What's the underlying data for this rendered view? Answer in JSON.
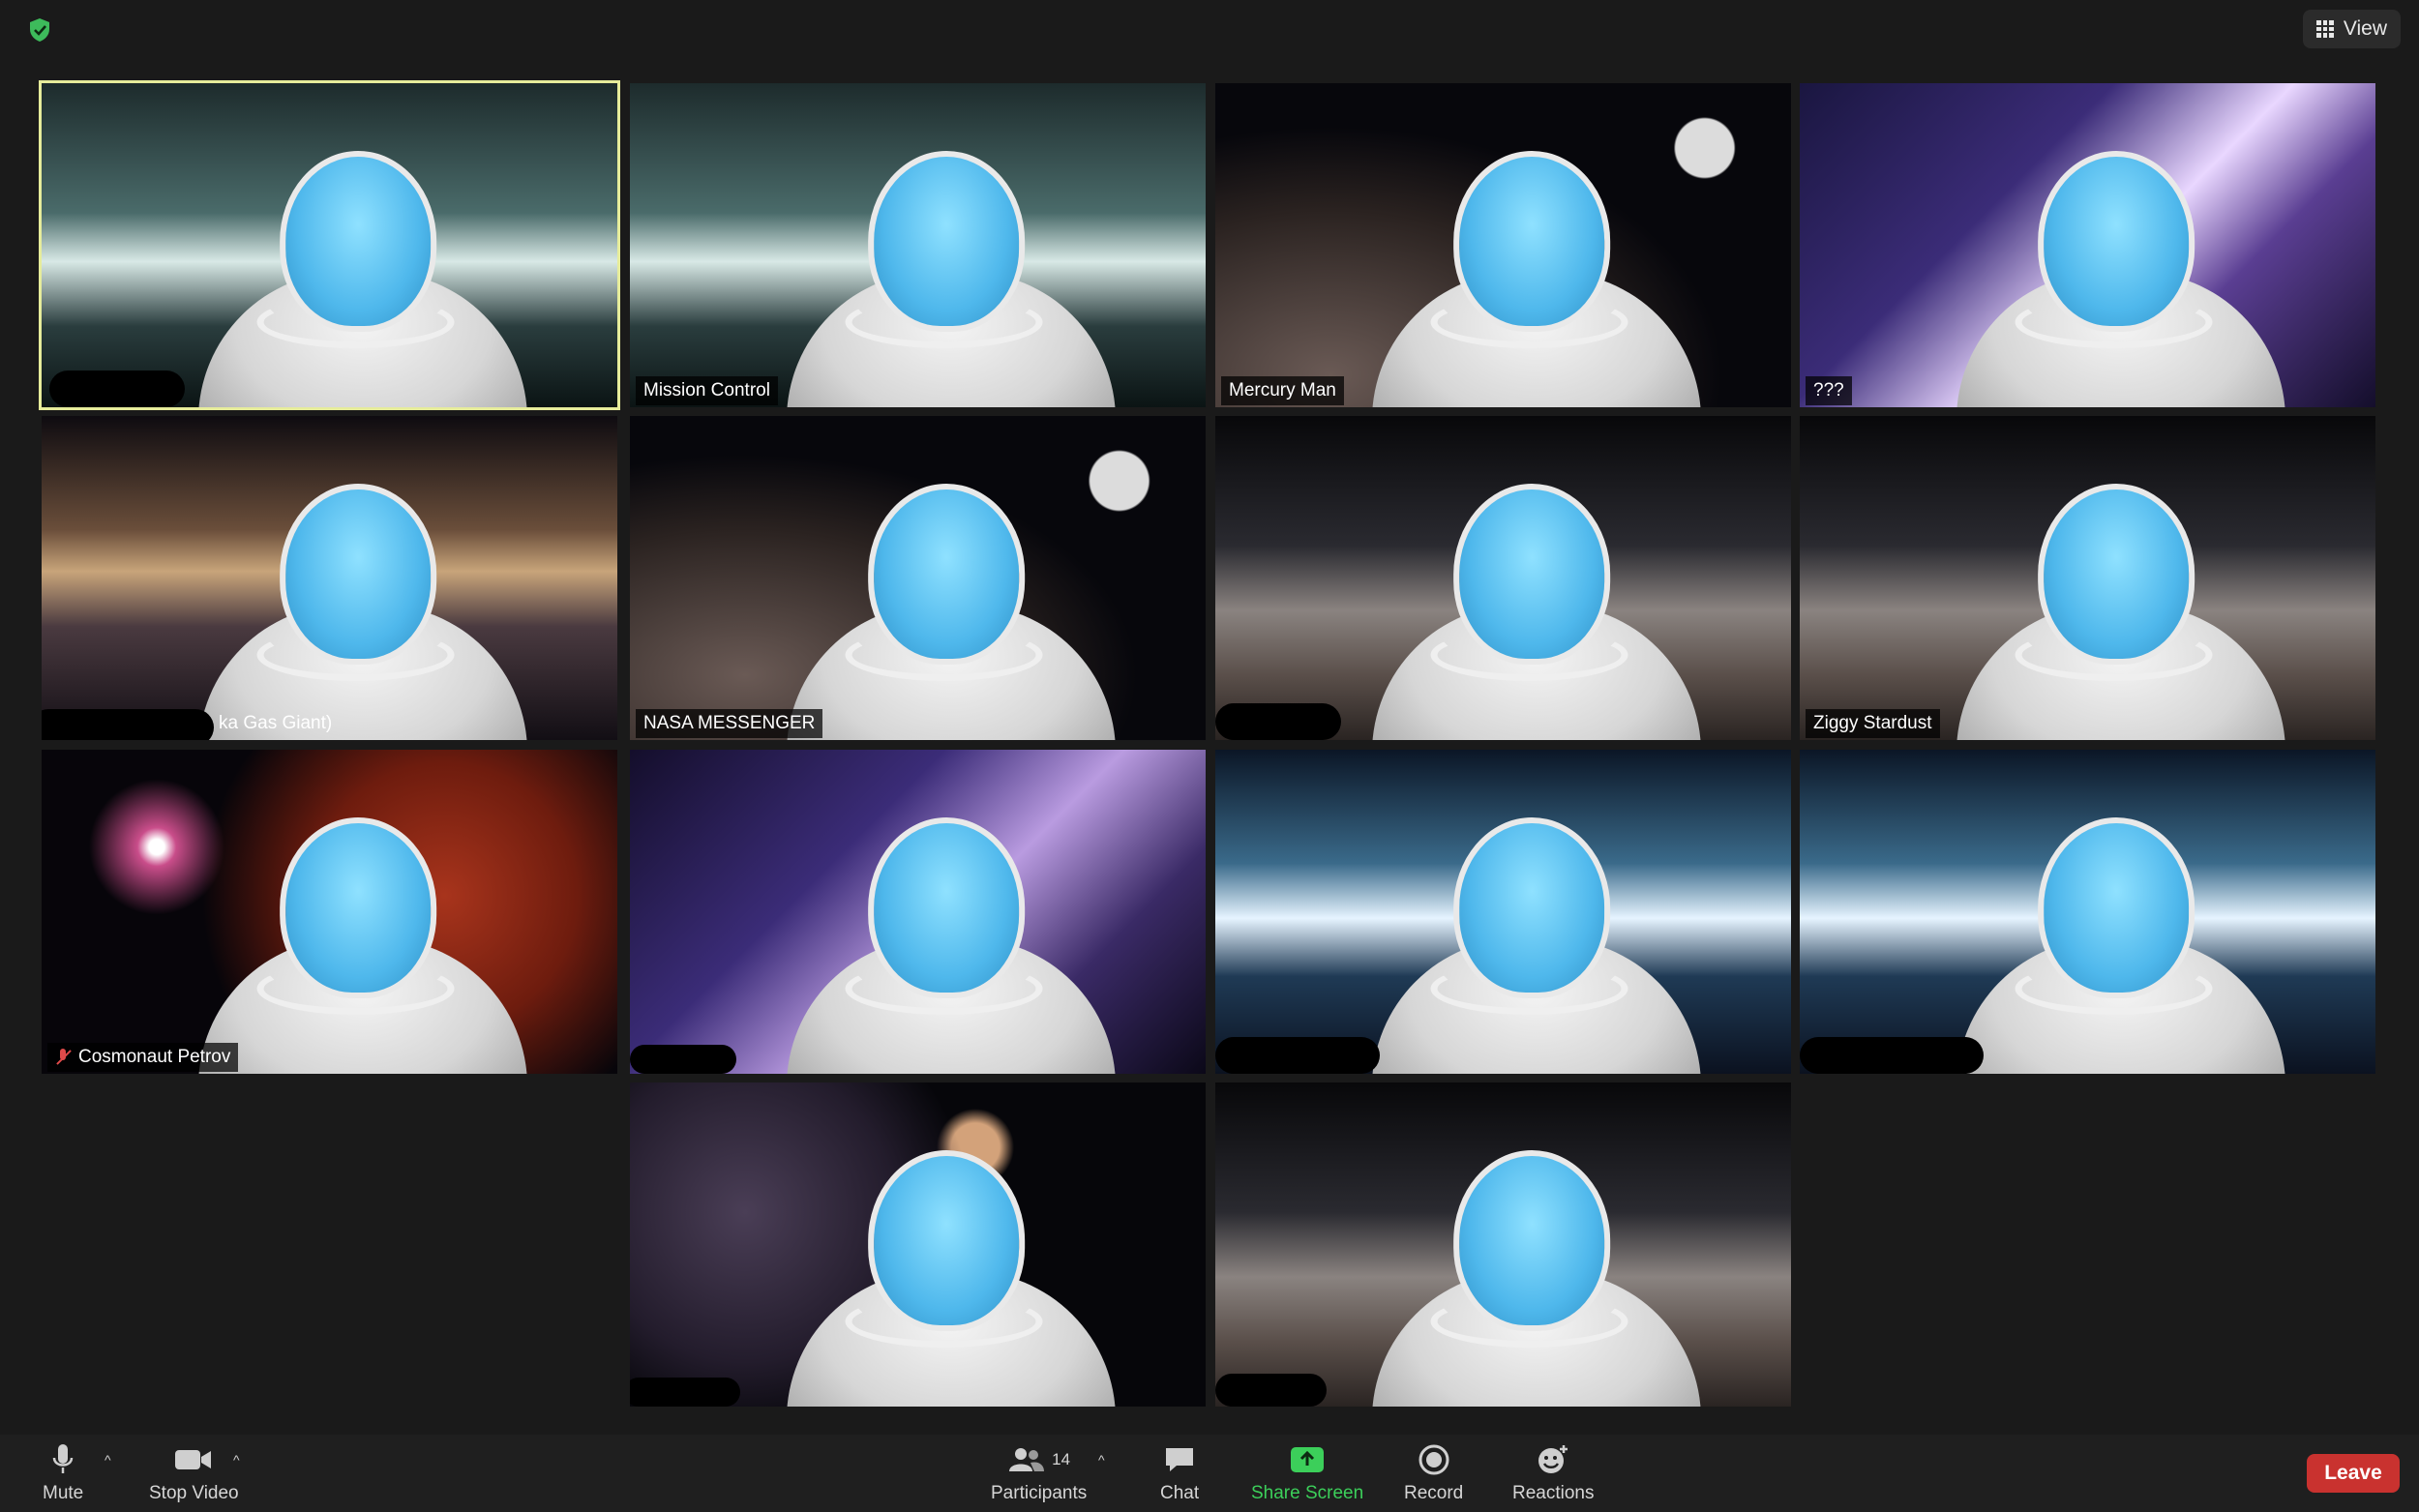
{
  "window": {
    "view_label": "View"
  },
  "tiles": [
    {
      "name": "",
      "theme": "corridor"
    },
    {
      "name": "Mission Control",
      "theme": "corridor"
    },
    {
      "name": "Mercury Man",
      "theme": "space"
    },
    {
      "name": "???",
      "theme": "city"
    },
    {
      "name": "ka Gas Giant)",
      "theme": "cloudcity"
    },
    {
      "name": "NASA MESSENGER",
      "theme": "space"
    },
    {
      "name": "",
      "theme": "desert"
    },
    {
      "name": "Ziggy Stardust",
      "theme": "desert"
    },
    {
      "name": "Cosmonaut Petrov",
      "theme": "redplanet"
    },
    {
      "name": "",
      "theme": "city"
    },
    {
      "name": "",
      "theme": "hangar"
    },
    {
      "name": "",
      "theme": "hangar"
    },
    {
      "name": "",
      "theme": "nebula"
    },
    {
      "name": "",
      "theme": "desert"
    }
  ],
  "toolbar": {
    "mute_label": "Mute",
    "stop_video_label": "Stop Video",
    "participants_label": "Participants",
    "participants_count": "14",
    "chat_label": "Chat",
    "share_label": "Share Screen",
    "record_label": "Record",
    "reactions_label": "Reactions",
    "leave_label": "Leave"
  },
  "colors": {
    "active_speaker_border": "#e6ec9b",
    "share_green": "#3ccf5a",
    "leave_red": "#c9322f",
    "secure_green": "#3dbb5b"
  }
}
